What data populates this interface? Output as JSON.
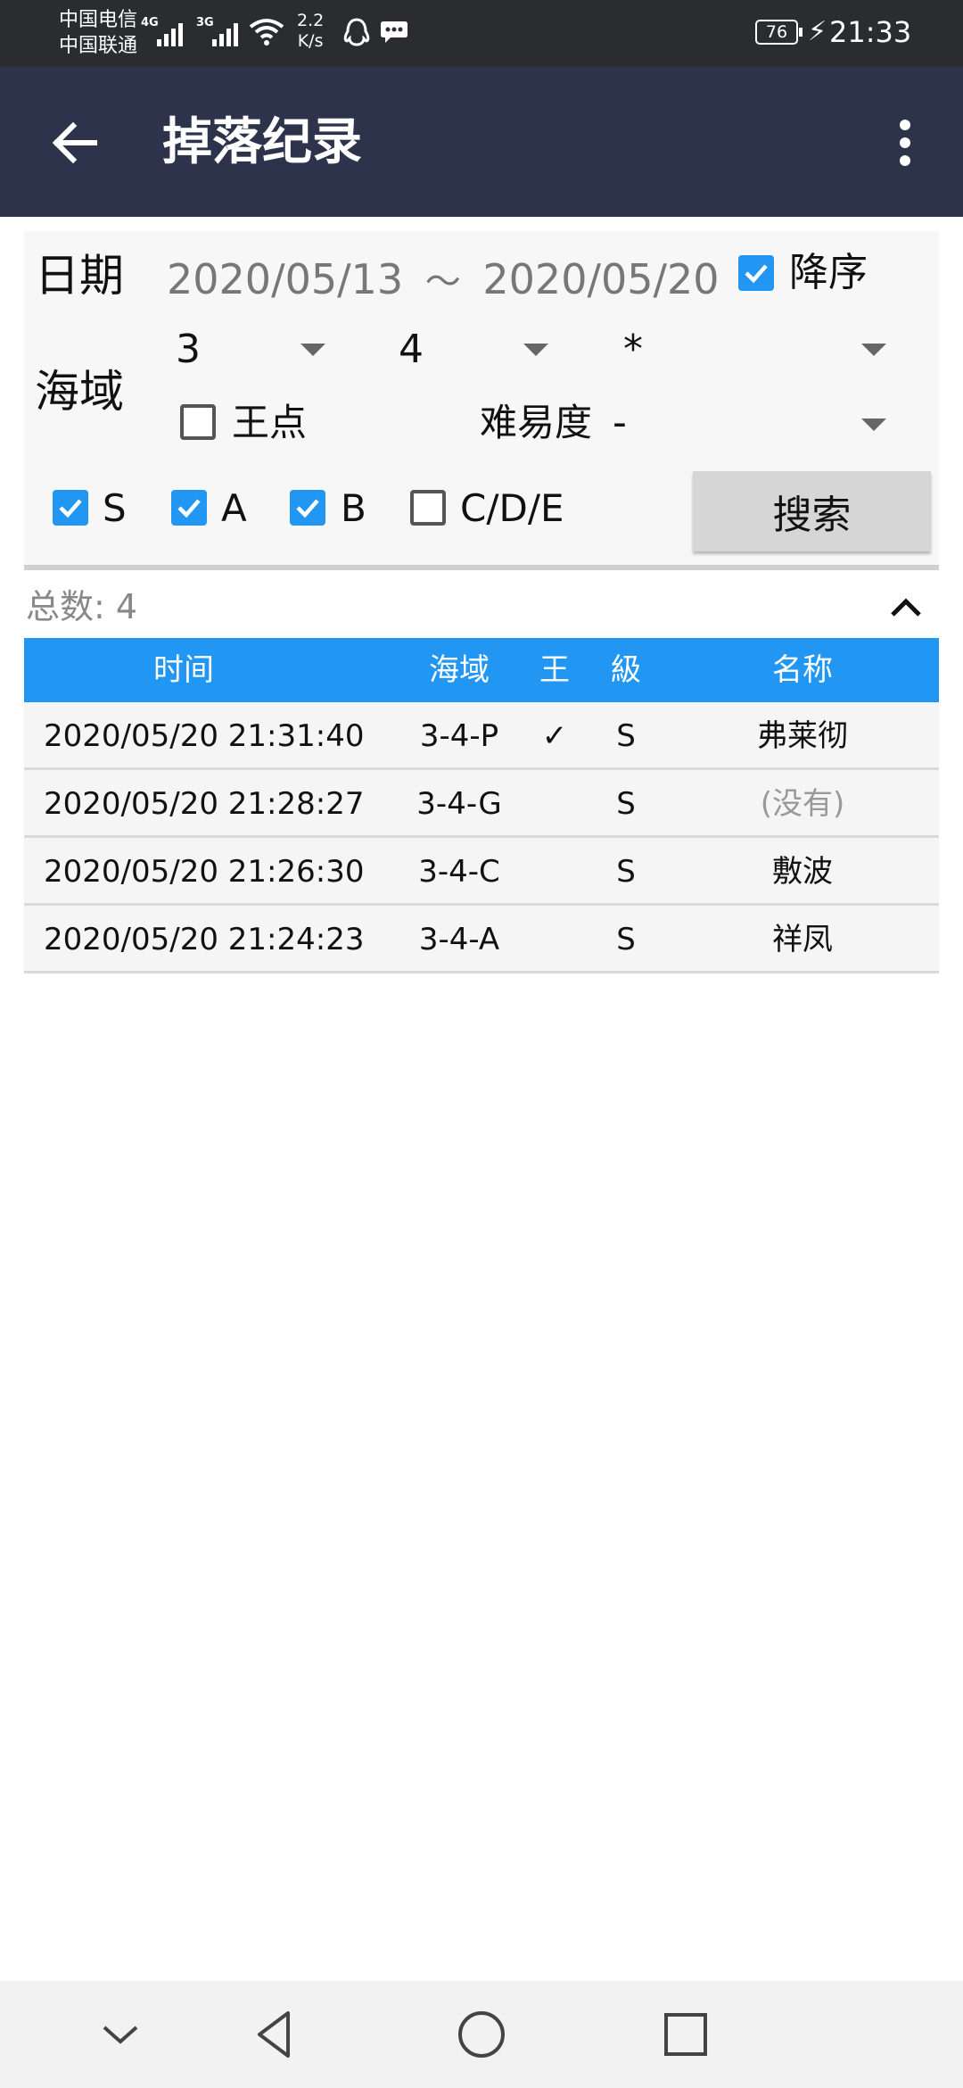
{
  "status_bar": {
    "carrier_1": "中国电信",
    "carrier_2": "中国联通",
    "net_1": "4G",
    "net_2": "3G",
    "speed_value": "2.2",
    "speed_unit": "K/s",
    "battery": "76",
    "time": "21:33"
  },
  "app_bar": {
    "title": "掉落纪录",
    "back_icon": "arrow-left-icon",
    "menu_icon": "more-vertical-icon"
  },
  "filter": {
    "date_label": "日期",
    "date_from": "2020/05/13",
    "date_sep": "～",
    "date_to": "2020/05/20",
    "descending_label": "降序",
    "descending_checked": true,
    "area_label": "海域",
    "world_value": "3",
    "map_value": "4",
    "point_value": "*",
    "boss_label": "王点",
    "boss_checked": false,
    "difficulty_label": "难易度",
    "difficulty_value": "-",
    "rank_s_label": "S",
    "rank_s_checked": true,
    "rank_a_label": "A",
    "rank_a_checked": true,
    "rank_b_label": "B",
    "rank_b_checked": true,
    "rank_cde_label": "C/D/E",
    "rank_cde_checked": false,
    "search_label": "搜索"
  },
  "summary": {
    "total_text": "总数: 4",
    "collapse_icon": "chevron-up-icon"
  },
  "table": {
    "headers": {
      "time": "时间",
      "area": "海域",
      "boss": "王",
      "rank": "級",
      "name": "名称"
    },
    "rows": [
      {
        "time": "2020/05/20 21:31:40",
        "area": "3-4-P",
        "boss": "✓",
        "rank": "S",
        "name": "弗莱彻"
      },
      {
        "time": "2020/05/20 21:28:27",
        "area": "3-4-G",
        "boss": "",
        "rank": "S",
        "name": "(没有)"
      },
      {
        "time": "2020/05/20 21:26:30",
        "area": "3-4-C",
        "boss": "",
        "rank": "S",
        "name": "敷波"
      },
      {
        "time": "2020/05/20 21:24:23",
        "area": "3-4-A",
        "boss": "",
        "rank": "S",
        "name": "祥凤"
      }
    ]
  },
  "nav_bar": {
    "icons": [
      "chevron-down-icon",
      "back-triangle-icon",
      "home-circle-icon",
      "recents-square-icon"
    ]
  },
  "colors": {
    "status_bar": "#2b2c30",
    "app_bar": "#2d334a",
    "accent": "#2196f3",
    "panel": "#f7f7f7"
  }
}
